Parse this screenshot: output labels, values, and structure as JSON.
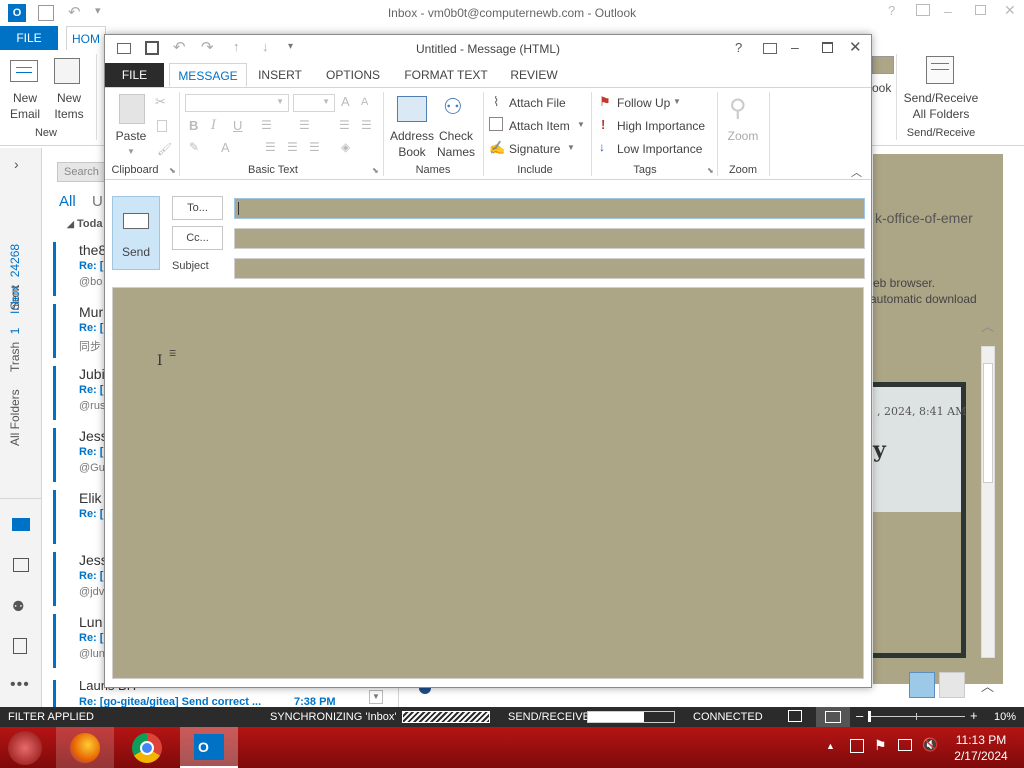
{
  "outlook": {
    "title": "Inbox - vm0b0t@computernewb.com - Outlook",
    "tabs": {
      "file": "FILE",
      "home": "HOM"
    },
    "ribbon": {
      "new_email": "New\nEmail",
      "new_items": "New\nItems",
      "new_group": "New",
      "send_receive": "Send/Receive\nAll Folders",
      "send_receive_group": "Send/Receive",
      "look_fragment": "ook"
    },
    "search": "Search",
    "filters": {
      "all": "All",
      "unread": "U"
    },
    "today": "Toda",
    "nav": {
      "inbox": "Inbox",
      "inbox_count": "24268",
      "sent": "Sent",
      "trash": "Trash",
      "trash_count": "1",
      "all_folders": "All Folders"
    },
    "mails": [
      {
        "name": "the8",
        "subject": "Re: [",
        "from": "@bo"
      },
      {
        "name": "Mur",
        "subject": "Re: [",
        "from": "同步"
      },
      {
        "name": "Jubi",
        "subject": "Re: [",
        "from": "@rus"
      },
      {
        "name": "Jess",
        "subject": "Re: [",
        "from": "@Gu"
      },
      {
        "name": "Elik",
        "subject": "Re: [",
        "from": ""
      },
      {
        "name": "Jess",
        "subject": "Re: [",
        "from": "@jdv"
      },
      {
        "name": "Lun",
        "subject": "Re: [",
        "from": "@lun"
      }
    ],
    "last_mail": {
      "name": "Launs BH",
      "subject": "Re: [go-gitea/gitea] Send correct ...",
      "time": "7:38 PM"
    },
    "reading": {
      "office_fragment": "k-office-of-emer",
      "browser_note": "eb browser.",
      "download_note": "automatic download",
      "date_fragment": ", 2024, 8:41 AM",
      "y_fragment": "y"
    },
    "status": {
      "filter": "FILTER APPLIED",
      "sync_prefix": "SYNCHRONIZING",
      "sync_folder": "'Inbox'",
      "send_receive": "SEND/RECEIVE",
      "connected": "CONNECTED",
      "zoom": "10%",
      "sync_progress": 1.0,
      "send_progress": 0.65
    }
  },
  "message": {
    "title": "Untitled - Message (HTML)",
    "tabs": [
      {
        "label": "FILE"
      },
      {
        "label": "MESSAGE"
      },
      {
        "label": "INSERT"
      },
      {
        "label": "OPTIONS"
      },
      {
        "label": "FORMAT TEXT"
      },
      {
        "label": "REVIEW"
      }
    ],
    "ribbon": {
      "paste": "Paste",
      "clipboard": "Clipboard",
      "basic_text": "Basic Text",
      "address_book": "Address\nBook",
      "check_names": "Check\nNames",
      "names": "Names",
      "attach_file": "Attach File",
      "attach_item": "Attach Item",
      "signature": "Signature",
      "include": "Include",
      "follow_up": "Follow Up",
      "high_importance": "High Importance",
      "low_importance": "Low Importance",
      "tags": "Tags",
      "zoom": "Zoom",
      "zoom_group": "Zoom"
    },
    "send": "Send",
    "to": "To...",
    "cc": "Cc...",
    "subject_label": "Subject",
    "to_value": "",
    "cc_value": "",
    "subject_value": "",
    "body_color": "#aca586"
  },
  "taskbar": {
    "time": "11:13 PM",
    "date": "2/17/2024"
  }
}
